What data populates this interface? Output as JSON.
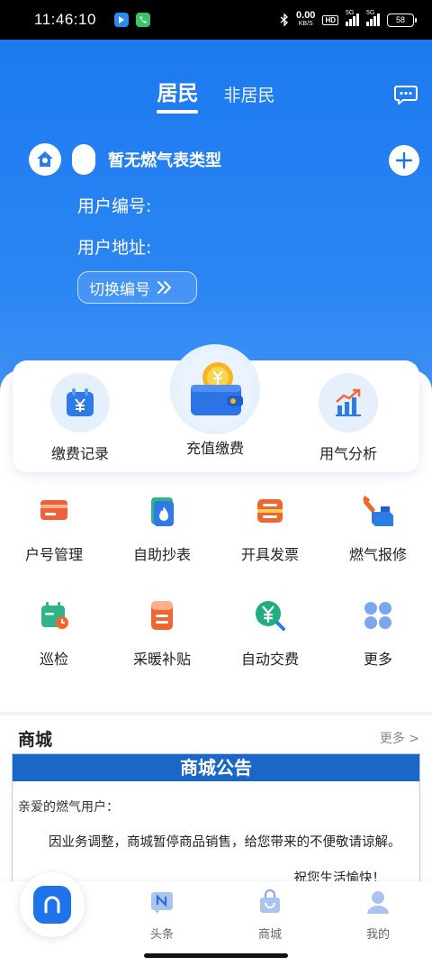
{
  "status_bar": {
    "time": "11:46:10",
    "net_speed_value": "0.00",
    "net_speed_unit": "KB/S",
    "hd": "HD",
    "signal1": "5G",
    "signal2": "5G",
    "battery": "58"
  },
  "header": {
    "tabs": [
      {
        "label": "居民",
        "active": true
      },
      {
        "label": "非居民",
        "active": false
      }
    ],
    "meter_type": "暂无燃气表类型",
    "user_no_label": "用户编号:",
    "user_addr_label": "用户地址:",
    "switch_label": "切换编号"
  },
  "quick_actions": [
    {
      "label": "缴费记录",
      "icon": "calendar-yen-icon"
    },
    {
      "label": "充值缴费",
      "icon": "wallet-coin-icon"
    },
    {
      "label": "用气分析",
      "icon": "bar-chart-icon"
    }
  ],
  "services": [
    {
      "label": "户号管理",
      "icon": "card-icon"
    },
    {
      "label": "自助抄表",
      "icon": "flame-meter-icon"
    },
    {
      "label": "开具发票",
      "icon": "invoice-icon"
    },
    {
      "label": "燃气报修",
      "icon": "wrench-icon"
    },
    {
      "label": "巡检",
      "icon": "calendar-clock-icon"
    },
    {
      "label": "采暖补贴",
      "icon": "heating-icon"
    },
    {
      "label": "自动交费",
      "icon": "yen-search-icon"
    },
    {
      "label": "更多",
      "icon": "grid-more-icon"
    }
  ],
  "mall": {
    "title": "商城",
    "more": "更多 >",
    "notice_title": "商城公告",
    "greeting": "亲爱的燃气用户：",
    "body": "因业务调整，商城暂停商品销售，给您带来的不便敬请谅解。",
    "sign": "祝您生活愉快！"
  },
  "bottom_nav": [
    {
      "label": "头条",
      "icon": "news-icon"
    },
    {
      "label": "商城",
      "icon": "shopping-bag-icon"
    },
    {
      "label": "我的",
      "icon": "user-icon"
    }
  ],
  "colors": {
    "primary": "#1f73ea",
    "header_bg": "#2c86f3"
  }
}
